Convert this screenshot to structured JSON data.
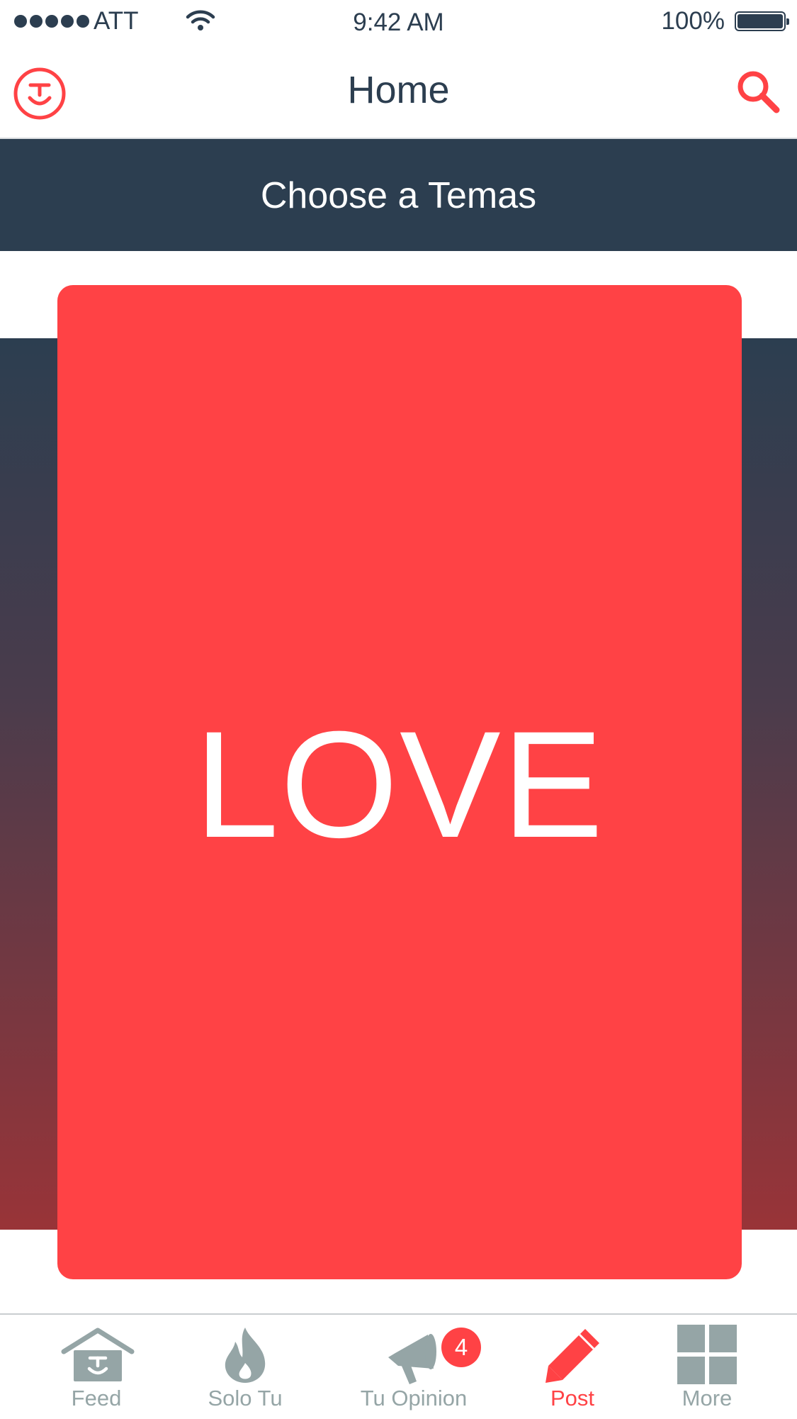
{
  "status_bar": {
    "carrier": "ATT",
    "time": "9:42 AM",
    "battery_percent": "100%"
  },
  "nav": {
    "title": "Home",
    "logo_icon": "smiley-logo-icon",
    "search_icon": "search-icon"
  },
  "section": {
    "title": "Choose a Temas"
  },
  "card": {
    "label": "LOVE",
    "color": "#ff4245"
  },
  "tabs": [
    {
      "label": "Feed",
      "icon": "home-icon",
      "active": false
    },
    {
      "label": "Solo Tu",
      "icon": "flame-icon",
      "active": false
    },
    {
      "label": "Tu Opinion",
      "icon": "megaphone-icon",
      "active": false,
      "badge": "4"
    },
    {
      "label": "Post",
      "icon": "pencil-icon",
      "active": true
    },
    {
      "label": "More",
      "icon": "grid-icon",
      "active": false
    }
  ],
  "colors": {
    "accent": "#ff4245",
    "navy": "#2c3e50",
    "inactive": "#95a5a6"
  }
}
